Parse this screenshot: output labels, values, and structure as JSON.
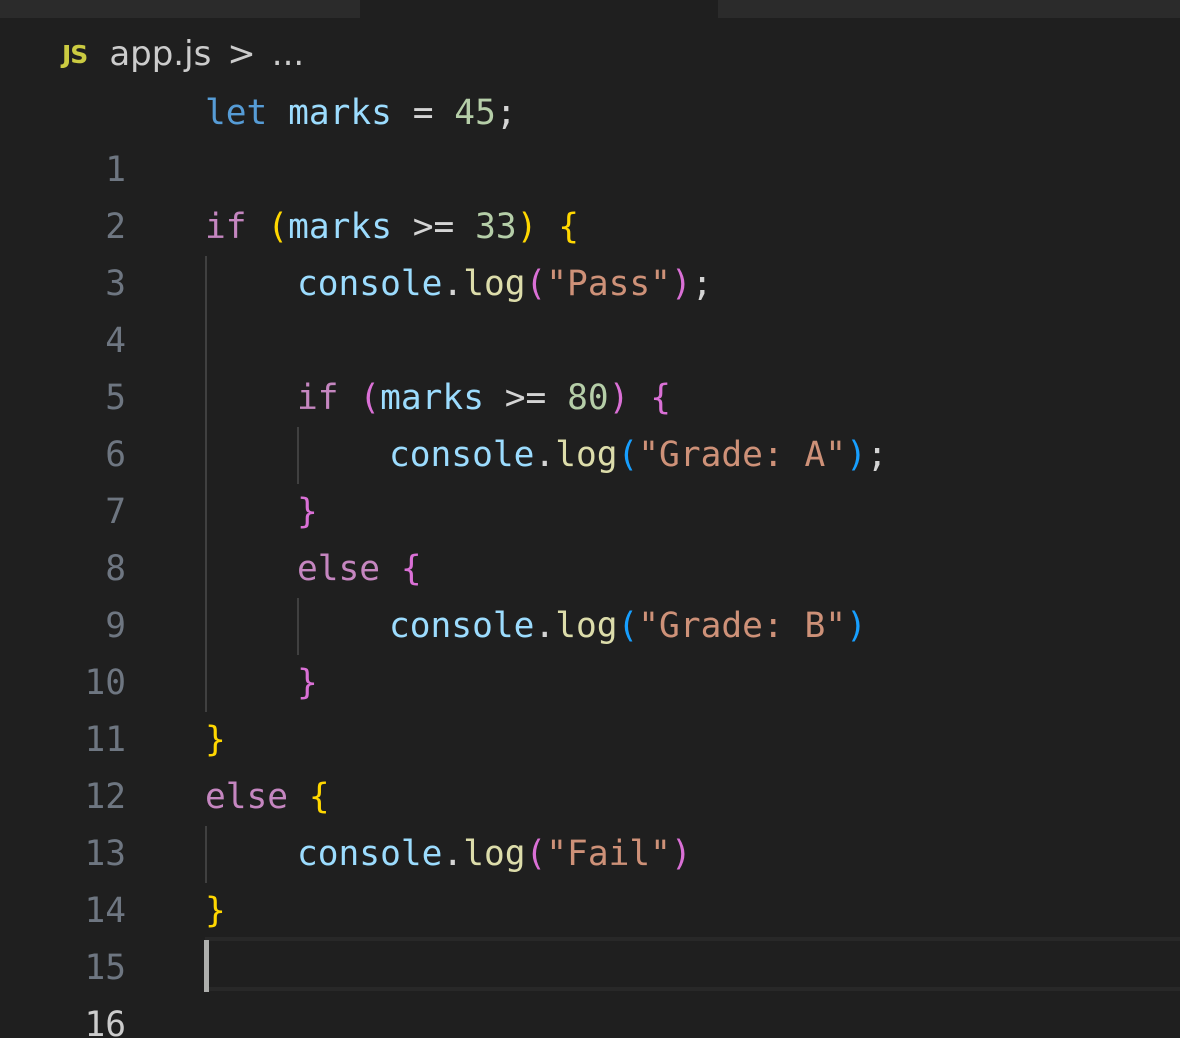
{
  "tabs": {
    "segments": [
      "tab-left",
      "tab-active",
      "tab-right"
    ]
  },
  "breadcrumb": {
    "icon": "JS",
    "file": "app.js",
    "separator": ">",
    "more": "..."
  },
  "lines": [
    {
      "number": "1",
      "tokens": [
        "let",
        " ",
        "marks",
        " ",
        "=",
        " ",
        "45",
        ";"
      ]
    },
    {
      "number": "2",
      "tokens": []
    },
    {
      "number": "3",
      "tokens": [
        "if",
        " ",
        "(",
        "marks",
        " ",
        ">=",
        " ",
        "33",
        ")",
        " ",
        "{"
      ]
    },
    {
      "number": "4",
      "tokens": [
        "console",
        ".",
        "log",
        "(",
        "\"Pass\"",
        ")",
        ";"
      ]
    },
    {
      "number": "5",
      "tokens": []
    },
    {
      "number": "6",
      "tokens": [
        "if",
        " ",
        "(",
        "marks",
        " ",
        ">=",
        " ",
        "80",
        ")",
        " ",
        "{"
      ]
    },
    {
      "number": "7",
      "tokens": [
        "console",
        ".",
        "log",
        "(",
        "\"Grade: A\"",
        ")",
        ";"
      ]
    },
    {
      "number": "8",
      "tokens": [
        "}"
      ]
    },
    {
      "number": "9",
      "tokens": [
        "else",
        " ",
        "{"
      ]
    },
    {
      "number": "10",
      "tokens": [
        "console",
        ".",
        "log",
        "(",
        "\"Grade: B\"",
        ")"
      ]
    },
    {
      "number": "11",
      "tokens": [
        "}"
      ]
    },
    {
      "number": "12",
      "tokens": [
        "}"
      ]
    },
    {
      "number": "13",
      "tokens": [
        "else",
        " ",
        "{"
      ]
    },
    {
      "number": "14",
      "tokens": [
        "console",
        ".",
        "log",
        "(",
        "\"Fail\"",
        ")"
      ]
    },
    {
      "number": "15",
      "tokens": [
        "}"
      ]
    },
    {
      "number": "16",
      "tokens": []
    }
  ],
  "current_line": "16",
  "colors": {
    "background": "#1f1f1f",
    "keyword": "#569cd6",
    "control": "#c586c0",
    "variable": "#9cdcfe",
    "number": "#b5cea8",
    "string": "#ce9178",
    "function": "#dcdcaa",
    "bracket_level1": "#ffd700",
    "bracket_level2": "#da70d6",
    "bracket_level3": "#179fff",
    "js_icon": "#cbcb41"
  }
}
